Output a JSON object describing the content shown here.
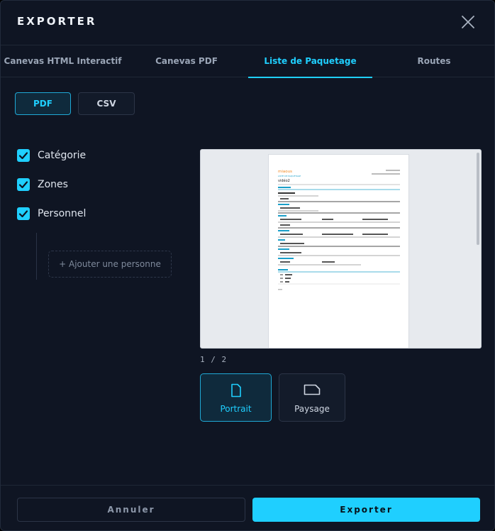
{
  "dialog": {
    "title": "EXPORTER"
  },
  "tabs": [
    {
      "label": "Canevas HTML Interactif",
      "active": false
    },
    {
      "label": "Canevas PDF",
      "active": false
    },
    {
      "label": "Liste de Paquetage",
      "active": true
    },
    {
      "label": "Routes",
      "active": false
    }
  ],
  "format": {
    "pdf_label": "PDF",
    "csv_label": "CSV",
    "selected": "PDF"
  },
  "options": [
    {
      "label": "Catégorie",
      "checked": true
    },
    {
      "label": "Zones",
      "checked": true
    },
    {
      "label": "Personnel",
      "checked": true
    }
  ],
  "personnel": {
    "add_label": "+ Ajouter une personne"
  },
  "preview": {
    "page_indicator": "1 / 2",
    "doc": {
      "brand": "miaous",
      "subtitle": "LISTE DE PAQUETAGE",
      "heading": "vidéo2"
    }
  },
  "orientation": {
    "portrait_label": "Portrait",
    "landscape_label": "Paysage",
    "selected": "Portrait"
  },
  "footer": {
    "cancel_label": "Annuler",
    "export_label": "Exporter"
  },
  "colors": {
    "accent": "#1fcfff",
    "background": "#0f1523",
    "border": "#2c3547"
  }
}
